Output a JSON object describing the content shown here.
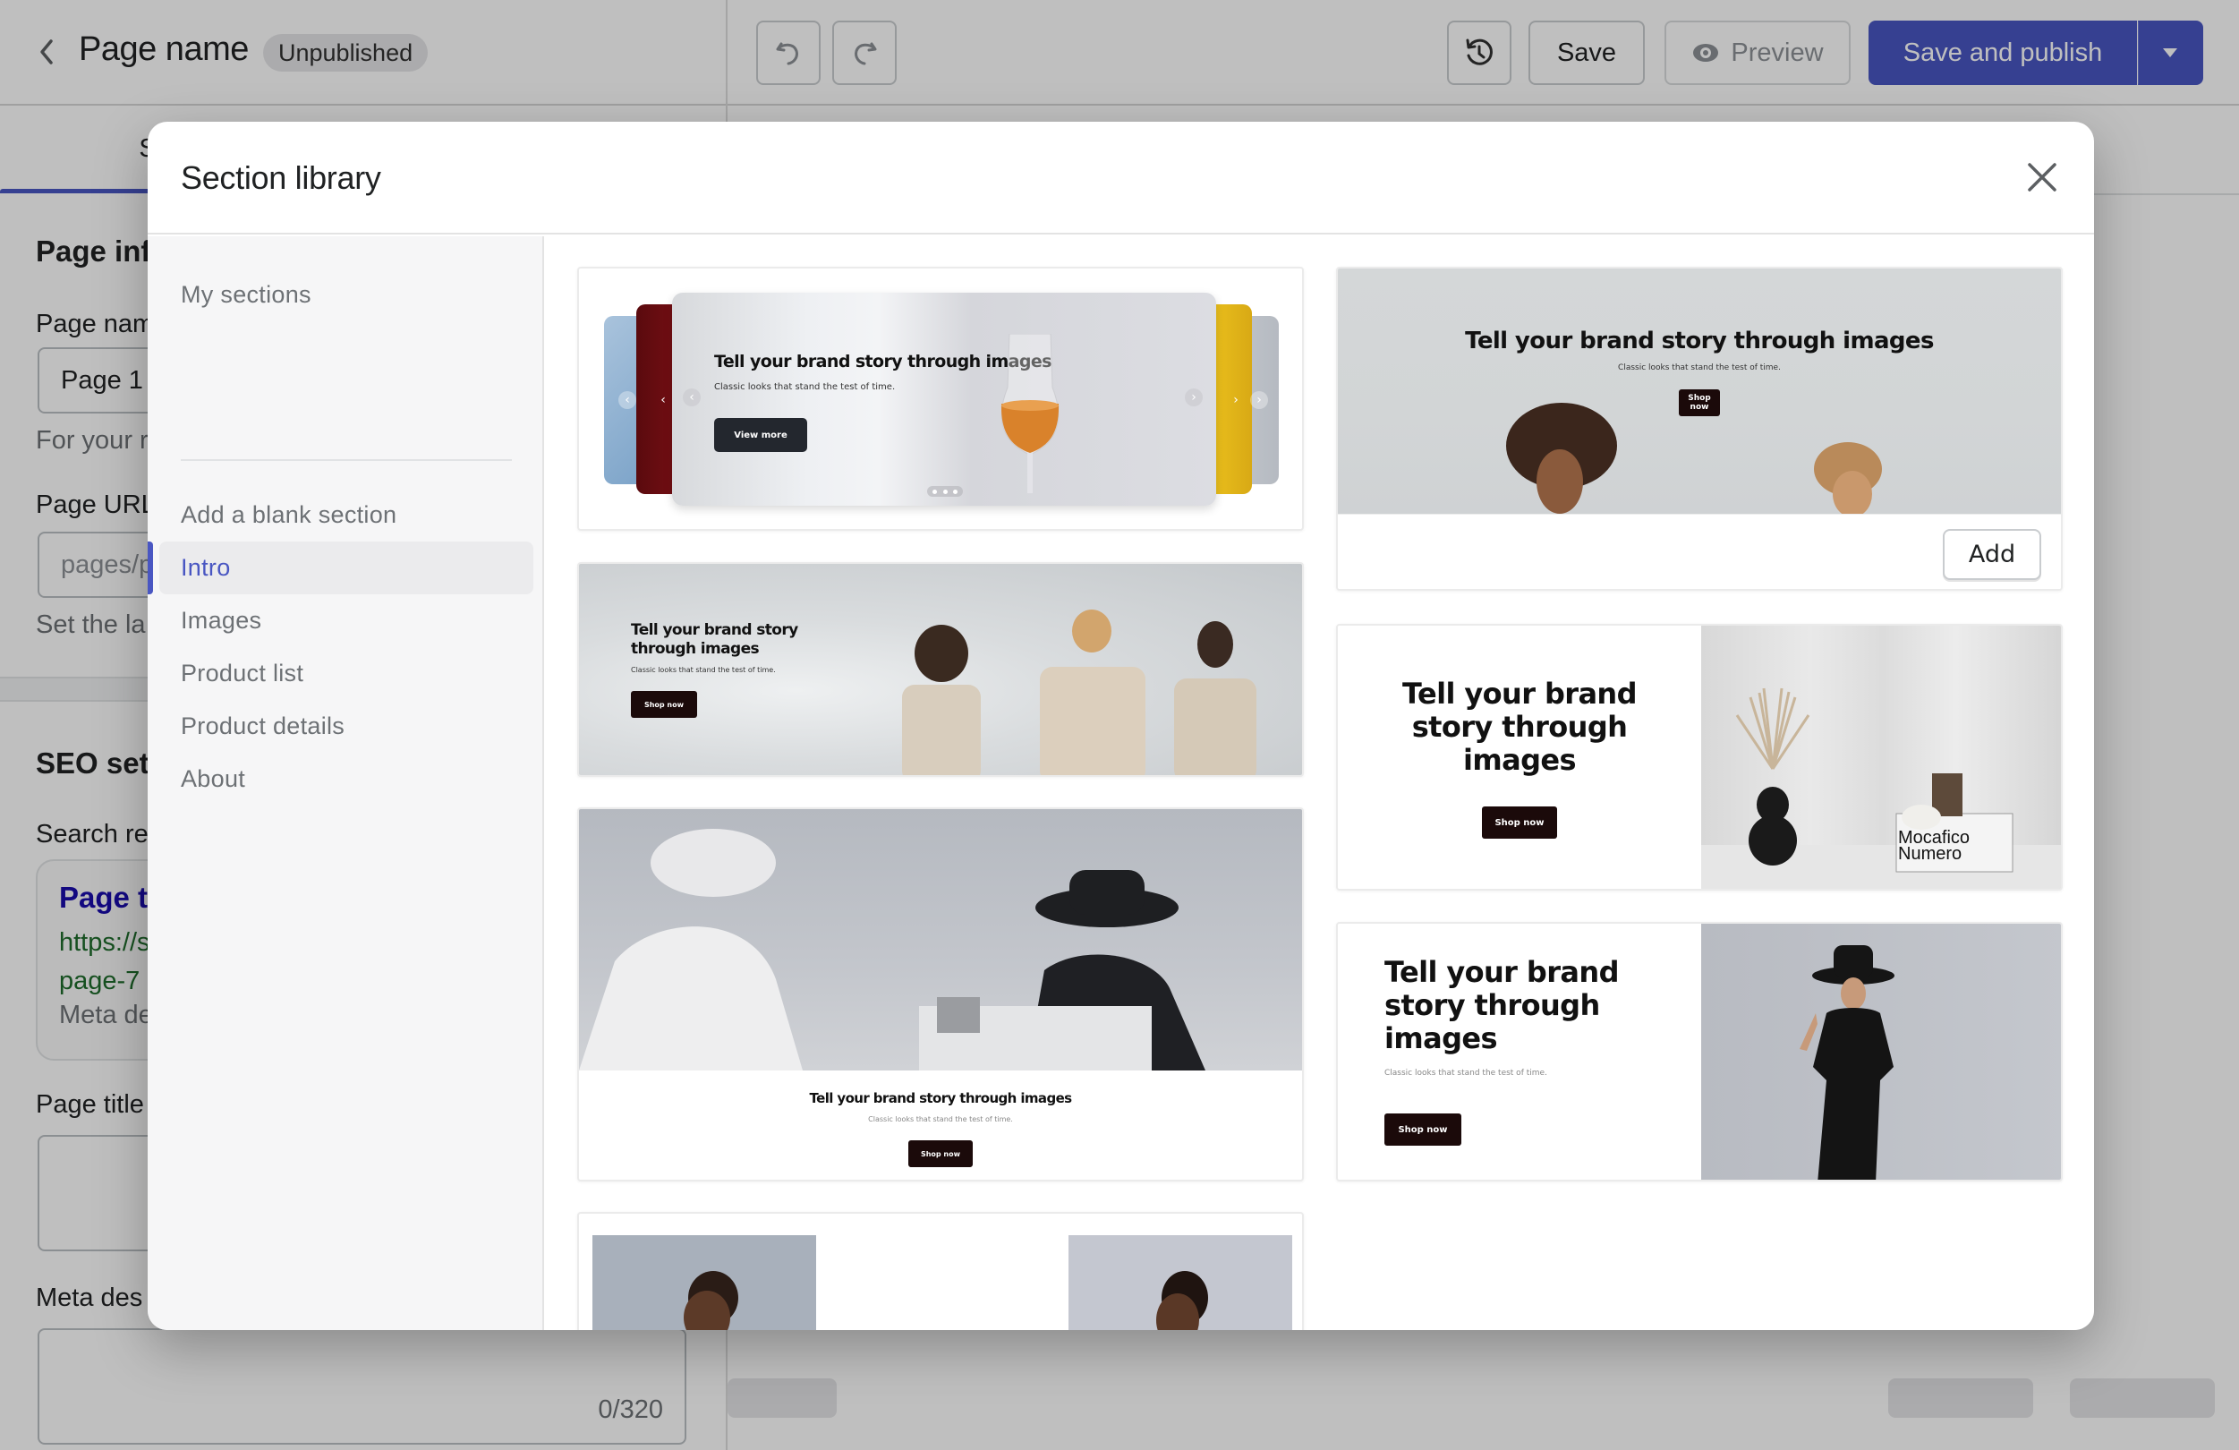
{
  "editor": {
    "page_name": "Page name",
    "status_badge": "Unpublished",
    "toolbar": {
      "undo_icon": "undo-icon",
      "redo_icon": "redo-icon",
      "history_icon": "history-icon",
      "save_label": "Save",
      "preview_label": "Preview",
      "preview_icon": "eye-icon",
      "publish_label": "Save and publish",
      "publish_menu_icon": "caret-down-icon"
    },
    "left_panel": {
      "active_tab_partial": "S",
      "page_info_heading": "Page inf",
      "page_name_label": "Page nam",
      "page_name_value": "Page 1",
      "page_name_help": "For your r",
      "page_url_label": "Page URL",
      "page_url_value": "pages/p",
      "page_url_help": "Set the la",
      "seo_heading": "SEO set",
      "search_result_label": "Search re",
      "seo_preview": {
        "title": "Page t",
        "url_line1": "https://s",
        "url_line2": "page-7",
        "description": "Meta de"
      },
      "page_title_label": "Page title",
      "meta_description_label": "Meta des",
      "meta_description_counter": "0/320"
    }
  },
  "modal": {
    "title": "Section library",
    "close_icon": "close-icon",
    "sidebar": {
      "items": [
        {
          "label": "My sections",
          "active": false
        },
        {
          "label": "Add a blank section",
          "active": false
        },
        {
          "label": "Intro",
          "active": true
        },
        {
          "label": "Images",
          "active": false
        },
        {
          "label": "Product list",
          "active": false
        },
        {
          "label": "Product details",
          "active": false
        },
        {
          "label": "About",
          "active": false
        }
      ]
    },
    "accent_color": "#4956c2",
    "templates": [
      {
        "id": "carousel",
        "heading": "Tell your brand story through images",
        "subheading": "Classic looks that stand the test of time.",
        "button": "View more"
      },
      {
        "id": "hero-centered-people",
        "heading": "Tell your brand story through images",
        "subheading": "Classic looks that stand the test of time.",
        "button": "Shop now",
        "add_label": "Add"
      },
      {
        "id": "hero-left-clouds",
        "heading": "Tell your brand story through images",
        "subheading": "Classic looks that stand the test of time.",
        "button": "Shop now"
      },
      {
        "id": "image-over-text",
        "heading": "Tell your brand story through images",
        "subheading": "Classic looks that stand the test of time.",
        "button": "Shop now"
      },
      {
        "id": "split-centered-vase",
        "heading": "Tell your brand story through images",
        "button": "Shop now",
        "book_text": "Mocafico Numero"
      },
      {
        "id": "split-left-fashion",
        "heading": "Tell your brand story through images",
        "subheading": "Classic looks that stand the test of time.",
        "button": "Shop now"
      },
      {
        "id": "portraits"
      }
    ]
  }
}
